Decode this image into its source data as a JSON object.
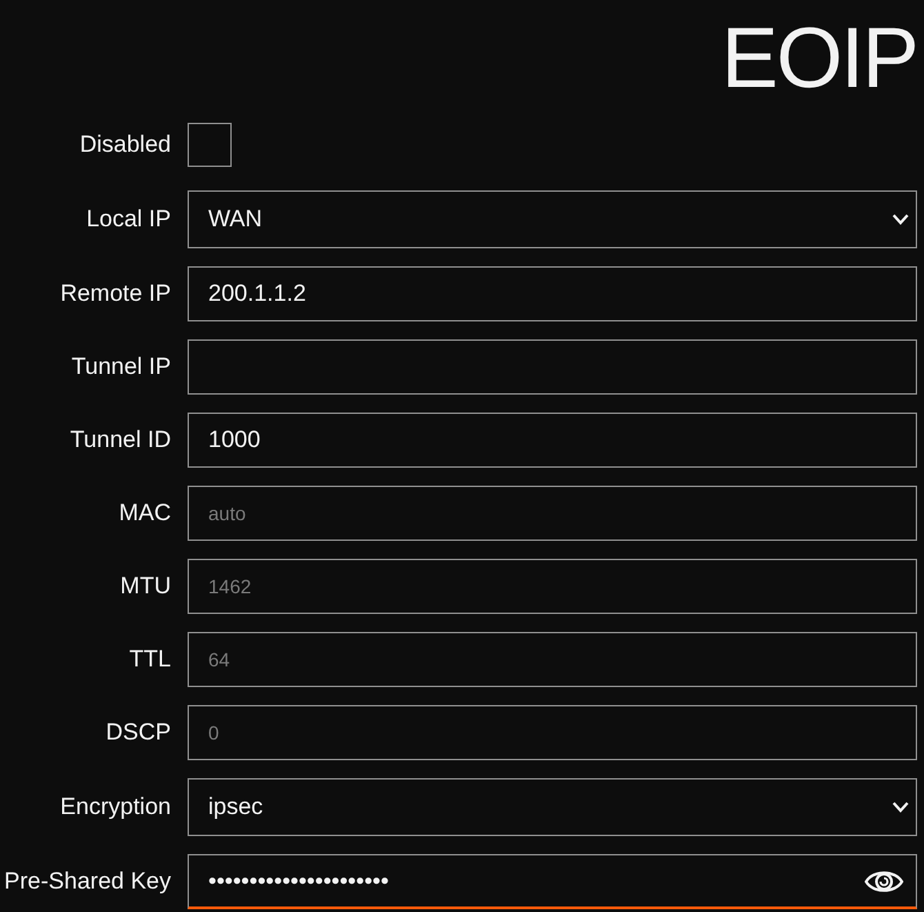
{
  "title": "EOIP",
  "fields": [
    {
      "kind": "checkbox",
      "label": "Disabled",
      "checked": false
    },
    {
      "kind": "select",
      "label": "Local IP",
      "value": "WAN",
      "focused": false
    },
    {
      "kind": "text",
      "label": "Remote IP",
      "value": "200.1.1.2",
      "focused": false
    },
    {
      "kind": "text",
      "label": "Tunnel IP",
      "focused": false
    },
    {
      "kind": "text",
      "label": "Tunnel ID",
      "value": "1000",
      "focused": false
    },
    {
      "kind": "text",
      "label": "MAC",
      "placeholder": "auto",
      "focused": false
    },
    {
      "kind": "text",
      "label": "MTU",
      "placeholder": "1462",
      "focused": false
    },
    {
      "kind": "text",
      "label": "TTL",
      "placeholder": "64",
      "focused": false
    },
    {
      "kind": "text",
      "label": "DSCP",
      "placeholder": "0",
      "focused": false
    },
    {
      "kind": "select",
      "label": "Encryption",
      "value": "ipsec",
      "focused": false
    },
    {
      "kind": "password",
      "label": "Pre-Shared Key",
      "value": "••••••••••••••••••••••",
      "focused": true
    }
  ]
}
